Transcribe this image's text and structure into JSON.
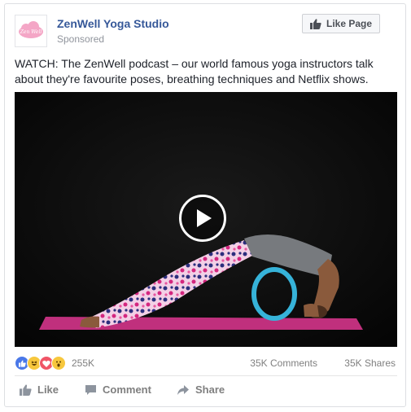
{
  "post": {
    "page_name": "ZenWell Yoga Studio",
    "sponsored_label": "Sponsored",
    "avatar_logo_text": "Zen Well",
    "like_page_label": "Like Page",
    "text": "WATCH: The ZenWell podcast – our world famous yoga instructors talk about they're favourite poses, breathing techniques and Netflix shows."
  },
  "video": {
    "state": "paused",
    "play_icon": "play-icon"
  },
  "engagement": {
    "reactions": [
      "like",
      "haha",
      "love",
      "wow"
    ],
    "reaction_count": "255K",
    "comments": "35K Comments",
    "shares": "35K Shares"
  },
  "actions": {
    "like": "Like",
    "comment": "Comment",
    "share": "Share"
  },
  "colors": {
    "page_name": "#365899",
    "logo_pink": "#f4a6c6",
    "mat": "#c0307d",
    "wheel": "#36b3d9"
  }
}
